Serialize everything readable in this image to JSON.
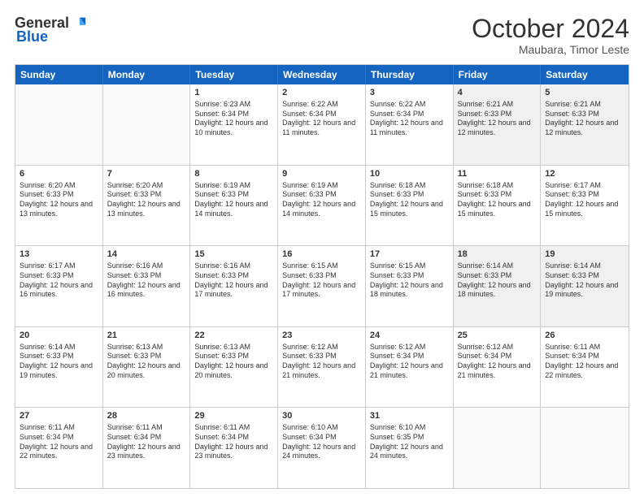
{
  "header": {
    "logo_general": "General",
    "logo_blue": "Blue",
    "month_year": "October 2024",
    "location": "Maubara, Timor Leste"
  },
  "weekdays": [
    "Sunday",
    "Monday",
    "Tuesday",
    "Wednesday",
    "Thursday",
    "Friday",
    "Saturday"
  ],
  "weeks": [
    [
      {
        "day": "",
        "info": "",
        "empty": true
      },
      {
        "day": "",
        "info": "",
        "empty": true
      },
      {
        "day": "1",
        "info": "Sunrise: 6:23 AM\nSunset: 6:34 PM\nDaylight: 12 hours and 10 minutes."
      },
      {
        "day": "2",
        "info": "Sunrise: 6:22 AM\nSunset: 6:34 PM\nDaylight: 12 hours and 11 minutes."
      },
      {
        "day": "3",
        "info": "Sunrise: 6:22 AM\nSunset: 6:34 PM\nDaylight: 12 hours and 11 minutes."
      },
      {
        "day": "4",
        "info": "Sunrise: 6:21 AM\nSunset: 6:33 PM\nDaylight: 12 hours and 12 minutes."
      },
      {
        "day": "5",
        "info": "Sunrise: 6:21 AM\nSunset: 6:33 PM\nDaylight: 12 hours and 12 minutes."
      }
    ],
    [
      {
        "day": "6",
        "info": "Sunrise: 6:20 AM\nSunset: 6:33 PM\nDaylight: 12 hours and 13 minutes."
      },
      {
        "day": "7",
        "info": "Sunrise: 6:20 AM\nSunset: 6:33 PM\nDaylight: 12 hours and 13 minutes."
      },
      {
        "day": "8",
        "info": "Sunrise: 6:19 AM\nSunset: 6:33 PM\nDaylight: 12 hours and 14 minutes."
      },
      {
        "day": "9",
        "info": "Sunrise: 6:19 AM\nSunset: 6:33 PM\nDaylight: 12 hours and 14 minutes."
      },
      {
        "day": "10",
        "info": "Sunrise: 6:18 AM\nSunset: 6:33 PM\nDaylight: 12 hours and 15 minutes."
      },
      {
        "day": "11",
        "info": "Sunrise: 6:18 AM\nSunset: 6:33 PM\nDaylight: 12 hours and 15 minutes."
      },
      {
        "day": "12",
        "info": "Sunrise: 6:17 AM\nSunset: 6:33 PM\nDaylight: 12 hours and 15 minutes."
      }
    ],
    [
      {
        "day": "13",
        "info": "Sunrise: 6:17 AM\nSunset: 6:33 PM\nDaylight: 12 hours and 16 minutes."
      },
      {
        "day": "14",
        "info": "Sunrise: 6:16 AM\nSunset: 6:33 PM\nDaylight: 12 hours and 16 minutes."
      },
      {
        "day": "15",
        "info": "Sunrise: 6:16 AM\nSunset: 6:33 PM\nDaylight: 12 hours and 17 minutes."
      },
      {
        "day": "16",
        "info": "Sunrise: 6:15 AM\nSunset: 6:33 PM\nDaylight: 12 hours and 17 minutes."
      },
      {
        "day": "17",
        "info": "Sunrise: 6:15 AM\nSunset: 6:33 PM\nDaylight: 12 hours and 18 minutes."
      },
      {
        "day": "18",
        "info": "Sunrise: 6:14 AM\nSunset: 6:33 PM\nDaylight: 12 hours and 18 minutes."
      },
      {
        "day": "19",
        "info": "Sunrise: 6:14 AM\nSunset: 6:33 PM\nDaylight: 12 hours and 19 minutes."
      }
    ],
    [
      {
        "day": "20",
        "info": "Sunrise: 6:14 AM\nSunset: 6:33 PM\nDaylight: 12 hours and 19 minutes."
      },
      {
        "day": "21",
        "info": "Sunrise: 6:13 AM\nSunset: 6:33 PM\nDaylight: 12 hours and 20 minutes."
      },
      {
        "day": "22",
        "info": "Sunrise: 6:13 AM\nSunset: 6:33 PM\nDaylight: 12 hours and 20 minutes."
      },
      {
        "day": "23",
        "info": "Sunrise: 6:12 AM\nSunset: 6:33 PM\nDaylight: 12 hours and 21 minutes."
      },
      {
        "day": "24",
        "info": "Sunrise: 6:12 AM\nSunset: 6:34 PM\nDaylight: 12 hours and 21 minutes."
      },
      {
        "day": "25",
        "info": "Sunrise: 6:12 AM\nSunset: 6:34 PM\nDaylight: 12 hours and 21 minutes."
      },
      {
        "day": "26",
        "info": "Sunrise: 6:11 AM\nSunset: 6:34 PM\nDaylight: 12 hours and 22 minutes."
      }
    ],
    [
      {
        "day": "27",
        "info": "Sunrise: 6:11 AM\nSunset: 6:34 PM\nDaylight: 12 hours and 22 minutes."
      },
      {
        "day": "28",
        "info": "Sunrise: 6:11 AM\nSunset: 6:34 PM\nDaylight: 12 hours and 23 minutes."
      },
      {
        "day": "29",
        "info": "Sunrise: 6:11 AM\nSunset: 6:34 PM\nDaylight: 12 hours and 23 minutes."
      },
      {
        "day": "30",
        "info": "Sunrise: 6:10 AM\nSunset: 6:34 PM\nDaylight: 12 hours and 24 minutes."
      },
      {
        "day": "31",
        "info": "Sunrise: 6:10 AM\nSunset: 6:35 PM\nDaylight: 12 hours and 24 minutes."
      },
      {
        "day": "",
        "info": "",
        "empty": true
      },
      {
        "day": "",
        "info": "",
        "empty": true
      }
    ]
  ]
}
